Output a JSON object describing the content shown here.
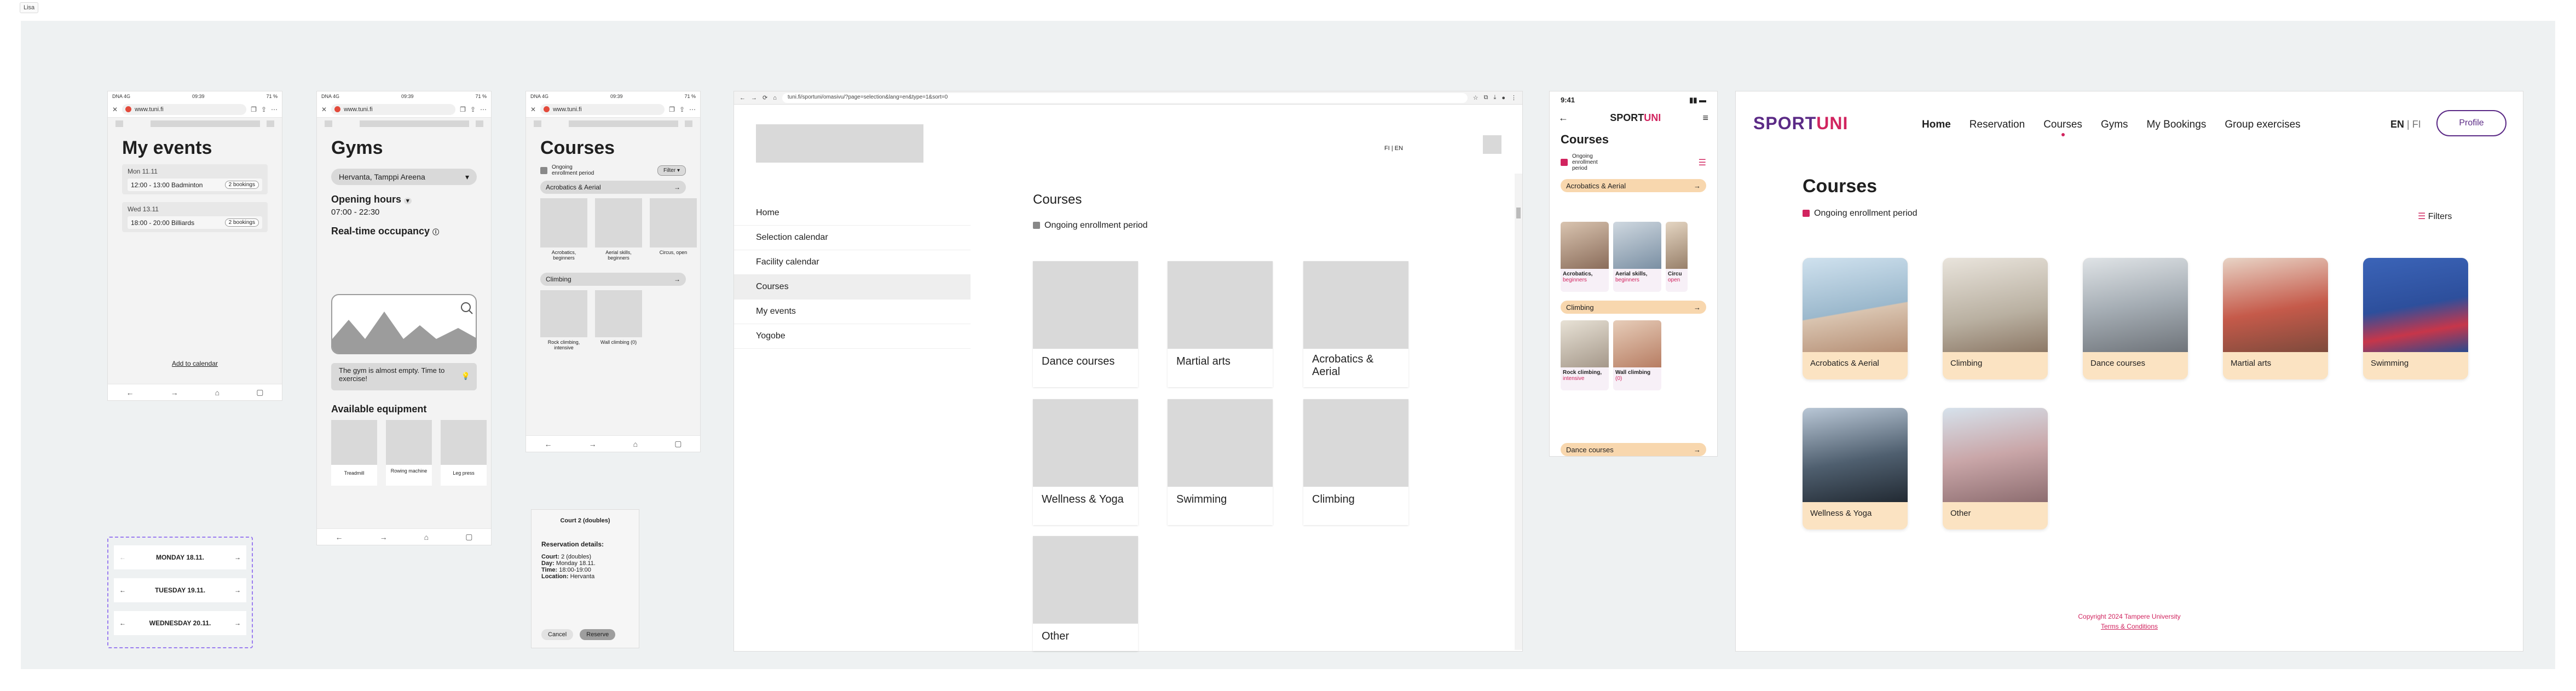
{
  "label": "Lisa",
  "status": {
    "carrier": "DNA 4G",
    "time": "09:39",
    "battery": "71 %"
  },
  "url_mobile": "www.tuni.fi",
  "events": {
    "title": "My events",
    "items": [
      {
        "date": "Mon 11.11",
        "time": "12:00 - 13:00 Badminton",
        "badge": "2 bookings"
      },
      {
        "date": "Wed 13.11",
        "time": "18:00 - 20:00 Billiards",
        "badge": "2 bookings"
      }
    ],
    "add_calendar": "Add to calendar"
  },
  "gyms": {
    "title": "Gyms",
    "select": "Hervanta, Tamppi Areena",
    "opening_title": "Opening hours",
    "hours": "07:00 - 22:30",
    "occupancy_title": "Real-time occupancy",
    "occupancy_text": "The gym is almost empty. Time to exercise!",
    "equipment_title": "Available equipment",
    "equipment": [
      "Treadmill",
      "Rowing machine",
      "Leg press"
    ]
  },
  "courses_wire": {
    "title": "Courses",
    "checkbox": "Ongoing enrollment period",
    "filter": "Filter",
    "cat1": "Acrobatics & Aerial",
    "cat1_items": [
      "Acrobatics, beginners",
      "Aerial skills, beginners",
      "Circus, open"
    ],
    "cat2": "Climbing",
    "cat2_items": [
      "Rock climbing, intensive",
      "Wall climbing (0)"
    ]
  },
  "days": [
    "MONDAY 18.11.",
    "TUESDAY 19.11.",
    "WEDNESDAY 20.11."
  ],
  "reservation": {
    "title": "Court 2 (doubles)",
    "details_title": "Reservation details:",
    "rows": [
      {
        "k": "Court:",
        "v": "2 (doubles)"
      },
      {
        "k": "Day:",
        "v": "Monday 18.11."
      },
      {
        "k": "Time:",
        "v": "18:00-19:00"
      },
      {
        "k": "Location:",
        "v": "Hervanta"
      }
    ],
    "cancel": "Cancel",
    "reserve": "Reserve"
  },
  "browser": {
    "url": "tuni.fi/sportuni/omasivu/?page=selection&lang=en&type=1&sort=0",
    "lang": "FI | EN",
    "nav": [
      "Home",
      "Selection calendar",
      "Facility calendar",
      "Courses",
      "My events",
      "Yogobe"
    ],
    "title": "Courses",
    "checkbox": "Ongoing enrollment period",
    "cards": [
      "Dance courses",
      "Martial arts",
      "Acrobatics & Aerial",
      "Wellness & Yoga",
      "Swimming",
      "Climbing",
      "Other"
    ]
  },
  "mobile": {
    "time": "9:41",
    "logo_a": "SPORT",
    "logo_b": "UNI",
    "title": "Courses",
    "checkbox": "Ongoing enrollment period",
    "cat1": "Acrobatics & Aerial",
    "cat1_items": [
      {
        "name": "Acrobatics,",
        "sub": "beginners"
      },
      {
        "name": "Aerial skills,",
        "sub": "beginners"
      },
      {
        "name": "Circu",
        "sub": "open"
      }
    ],
    "cat2": "Climbing",
    "cat2_items": [
      {
        "name": "Rock climbing,",
        "sub": "intensive"
      },
      {
        "name": "Wall climbing",
        "sub": "(0)"
      }
    ],
    "cat3": "Dance courses"
  },
  "desktop": {
    "logo_a": "SPORT",
    "logo_b": "UNI",
    "nav": [
      "Home",
      "Reservation",
      "Courses",
      "Gyms",
      "My Bookings",
      "Group exercises"
    ],
    "lang_en": "EN",
    "lang_sep": "|",
    "lang_fi": "FI",
    "profile": "Profile",
    "title": "Courses",
    "checkbox": "Ongoing enrollment period",
    "filters": "Filters",
    "cards": [
      "Acrobatics & Aerial",
      "Climbing",
      "Dance courses",
      "Martial arts",
      "Swimming",
      "Wellness & Yoga",
      "Other"
    ],
    "copyright": "Copyright 2024 Tampere University",
    "terms": "Terms & Conditions"
  },
  "colors": {
    "accent": "#d1245f",
    "brand": "#5b2a86",
    "card": "#fbe3c2"
  }
}
